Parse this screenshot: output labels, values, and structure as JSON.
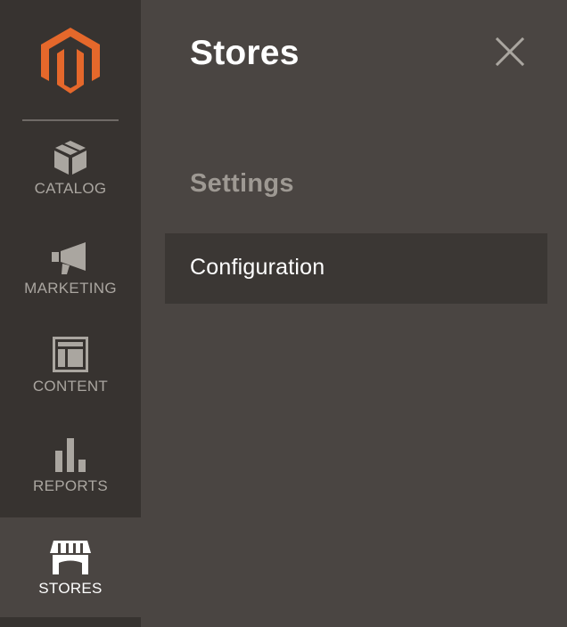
{
  "sidebar": {
    "logo_icon": "magento-logo-icon",
    "items": [
      {
        "label": "CATALOG",
        "icon": "box-icon"
      },
      {
        "label": "MARKETING",
        "icon": "megaphone-icon"
      },
      {
        "label": "CONTENT",
        "icon": "layout-icon"
      },
      {
        "label": "REPORTS",
        "icon": "bar-chart-icon"
      },
      {
        "label": "STORES",
        "icon": "storefront-icon",
        "active": true
      }
    ]
  },
  "panel": {
    "title": "Stores",
    "close_icon": "close-icon",
    "sections": [
      {
        "heading": "Settings",
        "items": [
          {
            "label": "Configuration"
          }
        ]
      }
    ]
  },
  "colors": {
    "sidebar_bg": "#373330",
    "panel_bg": "#4a4542",
    "item_bg": "#3b3734",
    "logo_orange": "#e5682b",
    "nav_text": "#aaa6a0",
    "active_text": "#ffffff",
    "heading_text": "#9e9993"
  }
}
